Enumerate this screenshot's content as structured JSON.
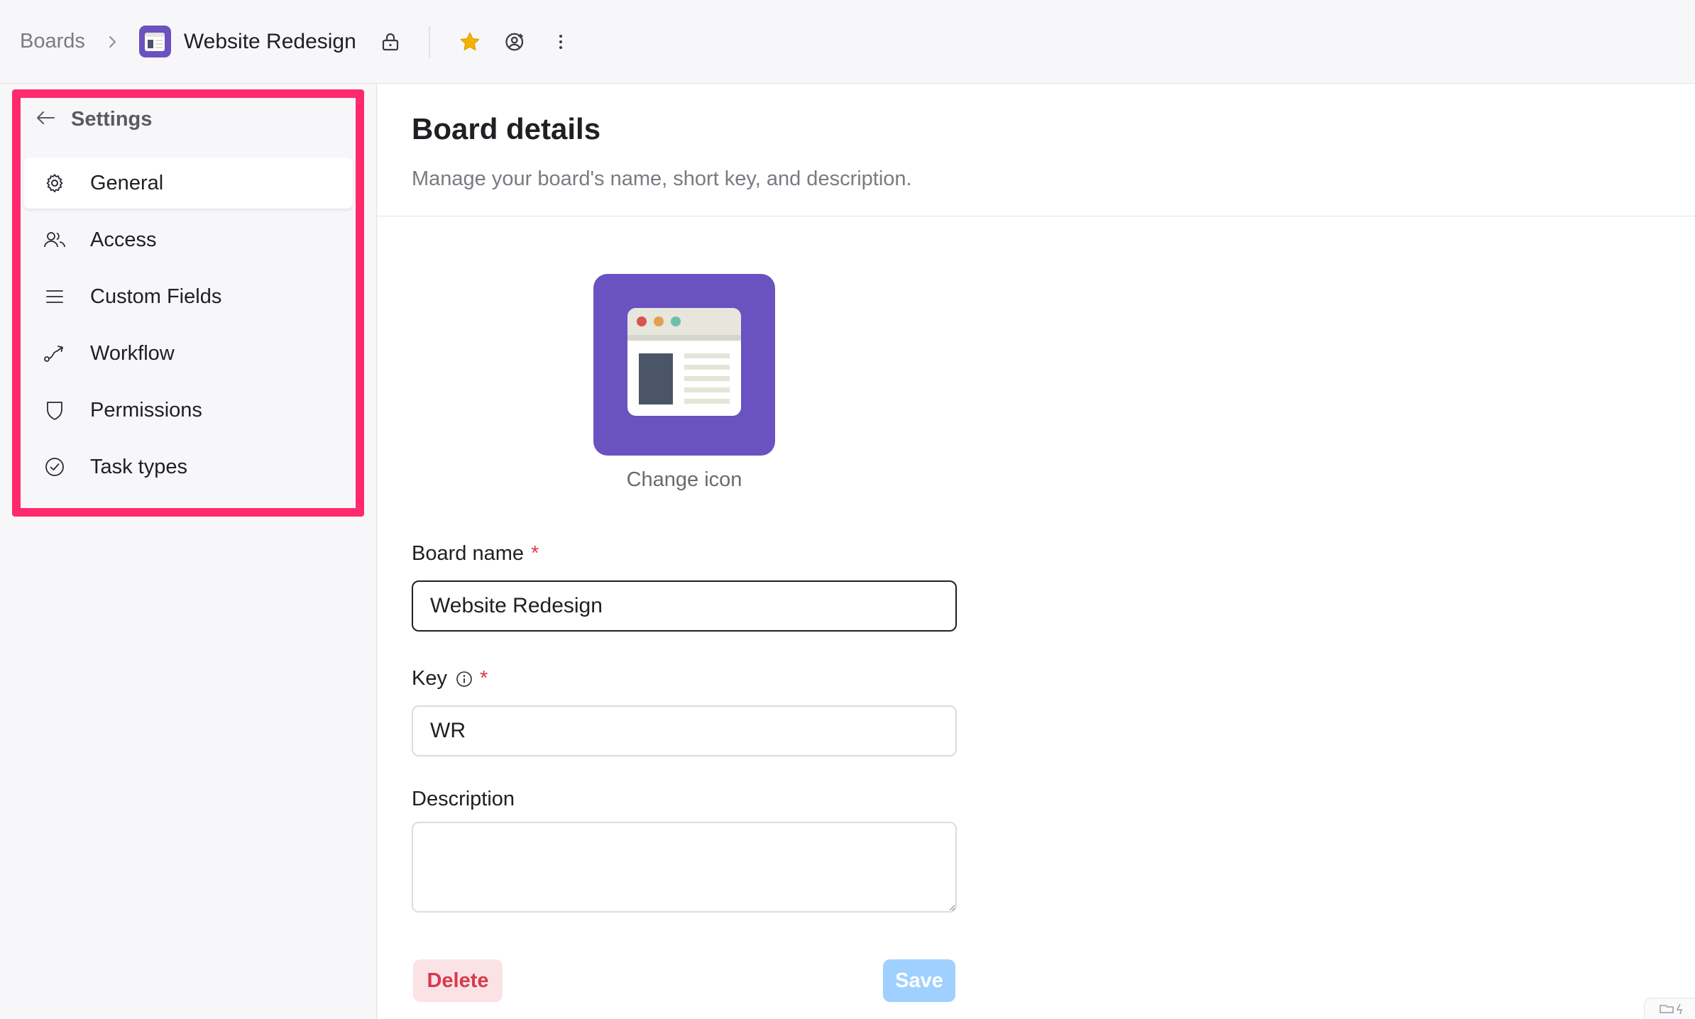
{
  "breadcrumb": {
    "root": "Boards",
    "board_title": "Website Redesign"
  },
  "colors": {
    "brand": "#6a52c1",
    "highlight": "#ff2a6d",
    "star": "#f5b301",
    "danger": "#d8394e",
    "save_disabled": "#9fd0ff"
  },
  "sidebar": {
    "back_label": "Settings",
    "items": [
      {
        "label": "General",
        "icon": "gear-icon",
        "active": true
      },
      {
        "label": "Access",
        "icon": "users-icon"
      },
      {
        "label": "Custom Fields",
        "icon": "list-icon"
      },
      {
        "label": "Workflow",
        "icon": "workflow-icon"
      },
      {
        "label": "Permissions",
        "icon": "shield-icon"
      },
      {
        "label": "Task types",
        "icon": "check-circle-icon"
      }
    ]
  },
  "main": {
    "title": "Board details",
    "subtitle": "Manage your board's name, short key, and description.",
    "change_icon_label": "Change icon",
    "board_name_label": "Board name",
    "board_name_value": "Website Redesign",
    "key_label": "Key",
    "key_value": "WR",
    "description_label": "Description",
    "description_value": "",
    "required_mark": "*",
    "delete_label": "Delete",
    "save_label": "Save"
  }
}
